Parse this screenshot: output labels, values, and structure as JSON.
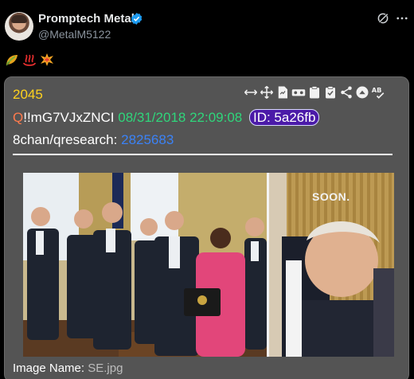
{
  "header": {
    "display_name": "Promptech Metal",
    "handle": "@MetalM5122",
    "verified": true,
    "icons": [
      "grok-icon",
      "more-icon"
    ]
  },
  "tweet": {
    "emojis": [
      "leaf-emoji",
      "hotsprings-emoji",
      "collision-emoji"
    ]
  },
  "card": {
    "post_number": "2045",
    "q_letter": "Q",
    "tripcode": "!!mG7VJxZNCI",
    "timestamp": "08/31/2018 22:09:08",
    "id_label": "ID: 5a26fb",
    "board": "8chan/qresearch:",
    "thread_number": "2825683",
    "toolbar_icons": [
      "resize-icon",
      "move-icon",
      "file-icon",
      "glasses-icon",
      "clipboard-icon",
      "clipboard-check-icon",
      "share-icon",
      "up-arrow-icon",
      "spellcheck-icon"
    ],
    "image_overlay_text": "SOON.",
    "image_name_label": "Image Name:",
    "image_name": "SE.jpg"
  },
  "colors": {
    "background": "#000000",
    "card": "#545454",
    "post_number": "#ffd21e",
    "q_letter": "#ff7a4c",
    "timestamp": "#2fd67b",
    "id_badge": "#4b1aa8",
    "thread_link": "#3b82f6",
    "verified": "#1d9bf0"
  }
}
